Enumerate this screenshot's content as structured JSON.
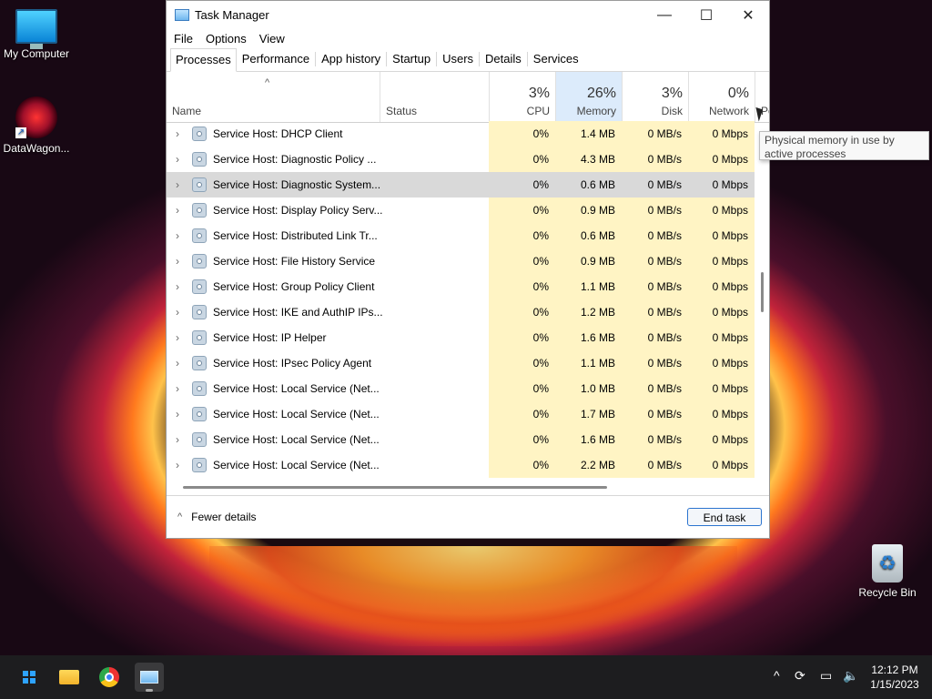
{
  "desktop": {
    "icons": [
      {
        "label": "My Computer"
      },
      {
        "label": "DataWagon..."
      },
      {
        "label": "Recycle Bin"
      }
    ]
  },
  "window": {
    "title": "Task Manager",
    "controls": {
      "minimize": "—",
      "maximize": "☐",
      "close": "✕"
    }
  },
  "menu": [
    "File",
    "Options",
    "View"
  ],
  "tabs": [
    "Processes",
    "Performance",
    "App history",
    "Startup",
    "Users",
    "Details",
    "Services"
  ],
  "active_tab": "Processes",
  "columns": {
    "name": "Name",
    "status": "Status",
    "cpu": {
      "pct": "3%",
      "label": "CPU"
    },
    "memory": {
      "pct": "26%",
      "label": "Memory"
    },
    "disk": {
      "pct": "3%",
      "label": "Disk"
    },
    "network": {
      "pct": "0%",
      "label": "Network"
    },
    "power": "Po"
  },
  "rows": [
    {
      "name": "Service Host: DHCP Client",
      "cpu": "0%",
      "mem": "1.4 MB",
      "disk": "0 MB/s",
      "net": "0 Mbps"
    },
    {
      "name": "Service Host: Diagnostic Policy ...",
      "cpu": "0%",
      "mem": "4.3 MB",
      "disk": "0 MB/s",
      "net": "0 Mbps"
    },
    {
      "name": "Service Host: Diagnostic System...",
      "cpu": "0%",
      "mem": "0.6 MB",
      "disk": "0 MB/s",
      "net": "0 Mbps",
      "selected": true
    },
    {
      "name": "Service Host: Display Policy Serv...",
      "cpu": "0%",
      "mem": "0.9 MB",
      "disk": "0 MB/s",
      "net": "0 Mbps"
    },
    {
      "name": "Service Host: Distributed Link Tr...",
      "cpu": "0%",
      "mem": "0.6 MB",
      "disk": "0 MB/s",
      "net": "0 Mbps"
    },
    {
      "name": "Service Host: File History Service",
      "cpu": "0%",
      "mem": "0.9 MB",
      "disk": "0 MB/s",
      "net": "0 Mbps"
    },
    {
      "name": "Service Host: Group Policy Client",
      "cpu": "0%",
      "mem": "1.1 MB",
      "disk": "0 MB/s",
      "net": "0 Mbps"
    },
    {
      "name": "Service Host: IKE and AuthIP IPs...",
      "cpu": "0%",
      "mem": "1.2 MB",
      "disk": "0 MB/s",
      "net": "0 Mbps"
    },
    {
      "name": "Service Host: IP Helper",
      "cpu": "0%",
      "mem": "1.6 MB",
      "disk": "0 MB/s",
      "net": "0 Mbps"
    },
    {
      "name": "Service Host: IPsec Policy Agent",
      "cpu": "0%",
      "mem": "1.1 MB",
      "disk": "0 MB/s",
      "net": "0 Mbps"
    },
    {
      "name": "Service Host: Local Service (Net...",
      "cpu": "0%",
      "mem": "1.0 MB",
      "disk": "0 MB/s",
      "net": "0 Mbps"
    },
    {
      "name": "Service Host: Local Service (Net...",
      "cpu": "0%",
      "mem": "1.7 MB",
      "disk": "0 MB/s",
      "net": "0 Mbps"
    },
    {
      "name": "Service Host: Local Service (Net...",
      "cpu": "0%",
      "mem": "1.6 MB",
      "disk": "0 MB/s",
      "net": "0 Mbps"
    },
    {
      "name": "Service Host: Local Service (Net...",
      "cpu": "0%",
      "mem": "2.2 MB",
      "disk": "0 MB/s",
      "net": "0 Mbps"
    }
  ],
  "tooltip": "Physical memory in use by active processes",
  "footer": {
    "fewer_details": "Fewer details",
    "end_task": "End task"
  },
  "taskbar": {
    "time": "12:12 PM",
    "date": "1/15/2023"
  }
}
